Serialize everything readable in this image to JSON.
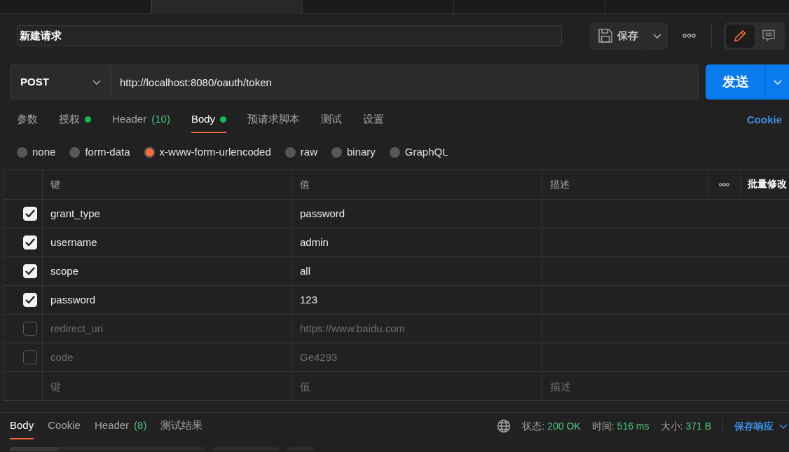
{
  "open_tabs": [
    {
      "selected": false
    },
    {
      "selected": true
    },
    {
      "selected": false
    },
    {
      "selected": false
    }
  ],
  "request": {
    "name": "新建请求",
    "save_label": "保存",
    "mode_buttons": [
      {
        "kind": "edit",
        "selected": true
      },
      {
        "kind": "comments",
        "selected": false
      }
    ]
  },
  "url_bar": {
    "method": "POST",
    "url": "http://localhost:8080/oauth/token",
    "send_label": "发送"
  },
  "request_tabs": [
    {
      "label": "参数",
      "indicator": false,
      "selected": false
    },
    {
      "label": "授权",
      "indicator": true,
      "selected": false
    },
    {
      "label": "Header",
      "count": "(10)",
      "indicator": false,
      "selected": false
    },
    {
      "label": "Body",
      "indicator": true,
      "selected": true
    },
    {
      "label": "预请求脚本",
      "indicator": false,
      "selected": false
    },
    {
      "label": "测试",
      "indicator": false,
      "selected": false
    },
    {
      "label": "设置",
      "indicator": false,
      "selected": false
    }
  ],
  "cookie_link": "Cookie",
  "body_types": [
    {
      "label": "none",
      "selected": false
    },
    {
      "label": "form-data",
      "selected": false
    },
    {
      "label": "x-www-form-urlencoded",
      "selected": true
    },
    {
      "label": "raw",
      "selected": false
    },
    {
      "label": "binary",
      "selected": false
    },
    {
      "label": "GraphQL",
      "selected": false
    }
  ],
  "params_table": {
    "columns": [
      "键",
      "值",
      "描述"
    ],
    "bulk_edit": "批量修改",
    "rows": [
      {
        "checked": true,
        "key": "grant_type",
        "value": "password"
      },
      {
        "checked": true,
        "key": "username",
        "value": "admin"
      },
      {
        "checked": true,
        "key": "scope",
        "value": "all"
      },
      {
        "checked": true,
        "key": "password",
        "value": "123"
      },
      {
        "checked": false,
        "key": "redirect_uri",
        "value": "https://www.baidu.com"
      },
      {
        "checked": false,
        "key": "code",
        "value": "Ge4293"
      }
    ],
    "new_row": [
      {
        "placeholder": "键"
      },
      {
        "placeholder": "值"
      },
      {
        "placeholder": "描述"
      }
    ]
  },
  "response": {
    "tabs": [
      {
        "label": "Body",
        "selected": true
      },
      {
        "label": "Cookie",
        "selected": false
      },
      {
        "label": "Header",
        "count": "(8)",
        "selected": false
      },
      {
        "label": "测试结果",
        "selected": false
      }
    ],
    "stats": [
      {
        "label": "状态:",
        "value": "200 OK"
      },
      {
        "label": "时间:",
        "value": "516 ms"
      },
      {
        "label": "大小:",
        "value": "371 B"
      }
    ],
    "save_label": "保存响应"
  }
}
